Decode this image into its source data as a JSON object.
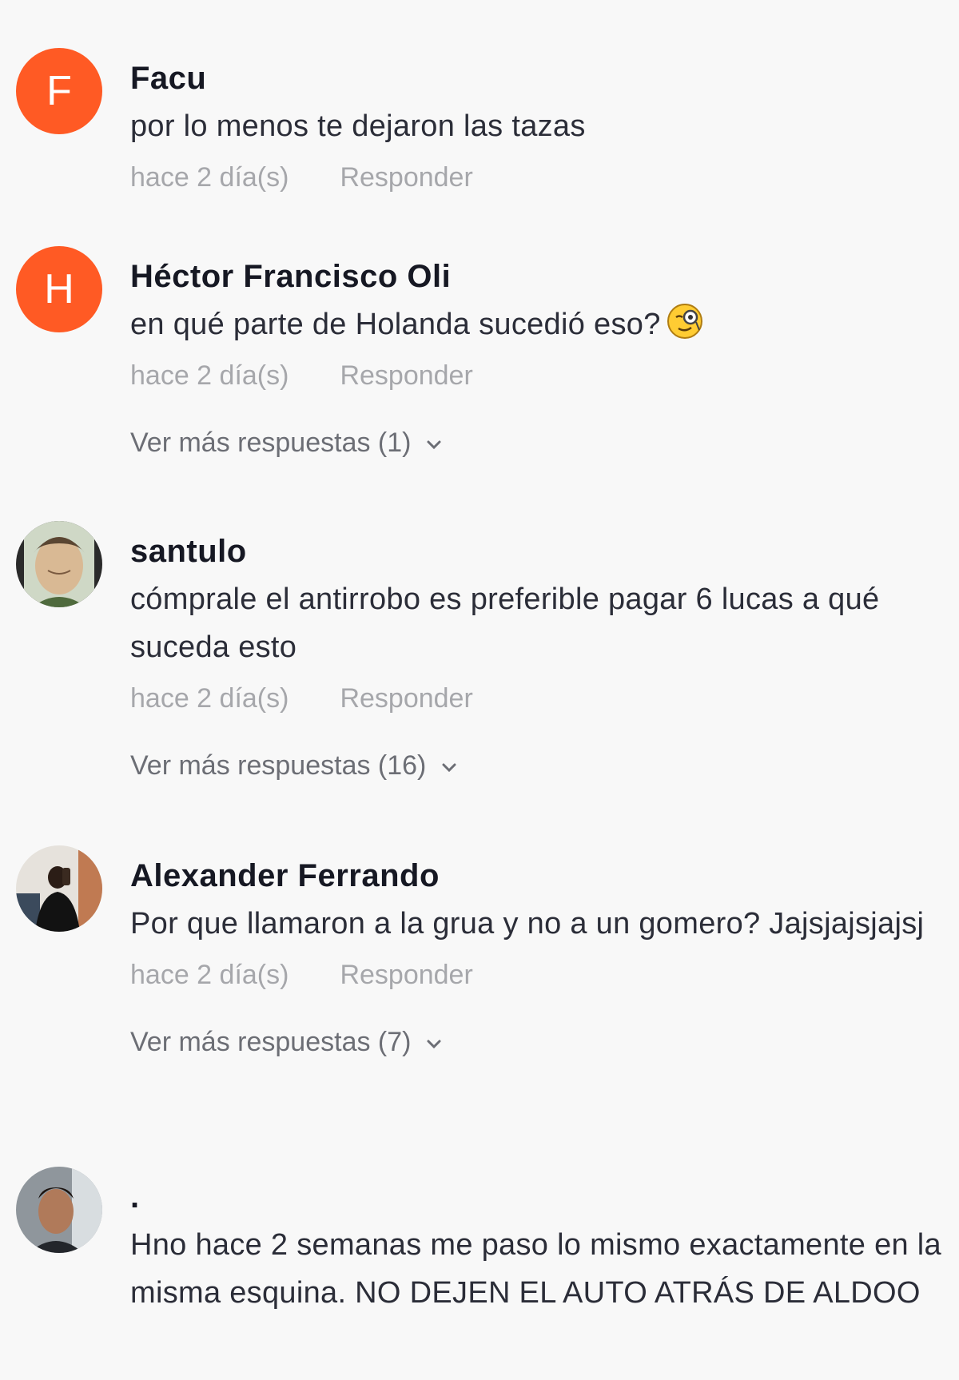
{
  "comments": [
    {
      "avatar_letter": "F",
      "username": "Facu",
      "text": "por lo menos te dejaron las tazas",
      "time": "hace 2 día(s)",
      "reply_label": "Responder"
    },
    {
      "avatar_letter": "H",
      "username": "Héctor Francisco Oli",
      "text": "en qué parte de Holanda sucedió eso?",
      "emoji": "monocle-face-emoji",
      "time": "hace 2 día(s)",
      "reply_label": "Responder",
      "more_replies": "Ver más respuestas (1)"
    },
    {
      "username": "santulo",
      "text": "cómprale el antirrobo es preferible pagar 6 lucas a qué suceda esto",
      "time": "hace 2 día(s)",
      "reply_label": "Responder",
      "more_replies": "Ver más respuestas (16)"
    },
    {
      "username": "Alexander Ferrando",
      "text": "Por que llamaron a la grua y no a un gomero? Jajsjajsjajsj",
      "time": "hace 2 día(s)",
      "reply_label": "Responder",
      "more_replies": "Ver más respuestas (7)"
    },
    {
      "username": ".",
      "text": "Hno hace 2 semanas me paso lo mismo exactamente en la misma esquina. NO DEJEN EL AUTO ATRÁS DE ALDOO"
    }
  ],
  "colors": {
    "background": "#f8f8f8",
    "avatar_letter_bg": "#ff5a24",
    "username": "#161823",
    "meta": "#a6a7ab",
    "more_replies": "#6c6e75"
  }
}
